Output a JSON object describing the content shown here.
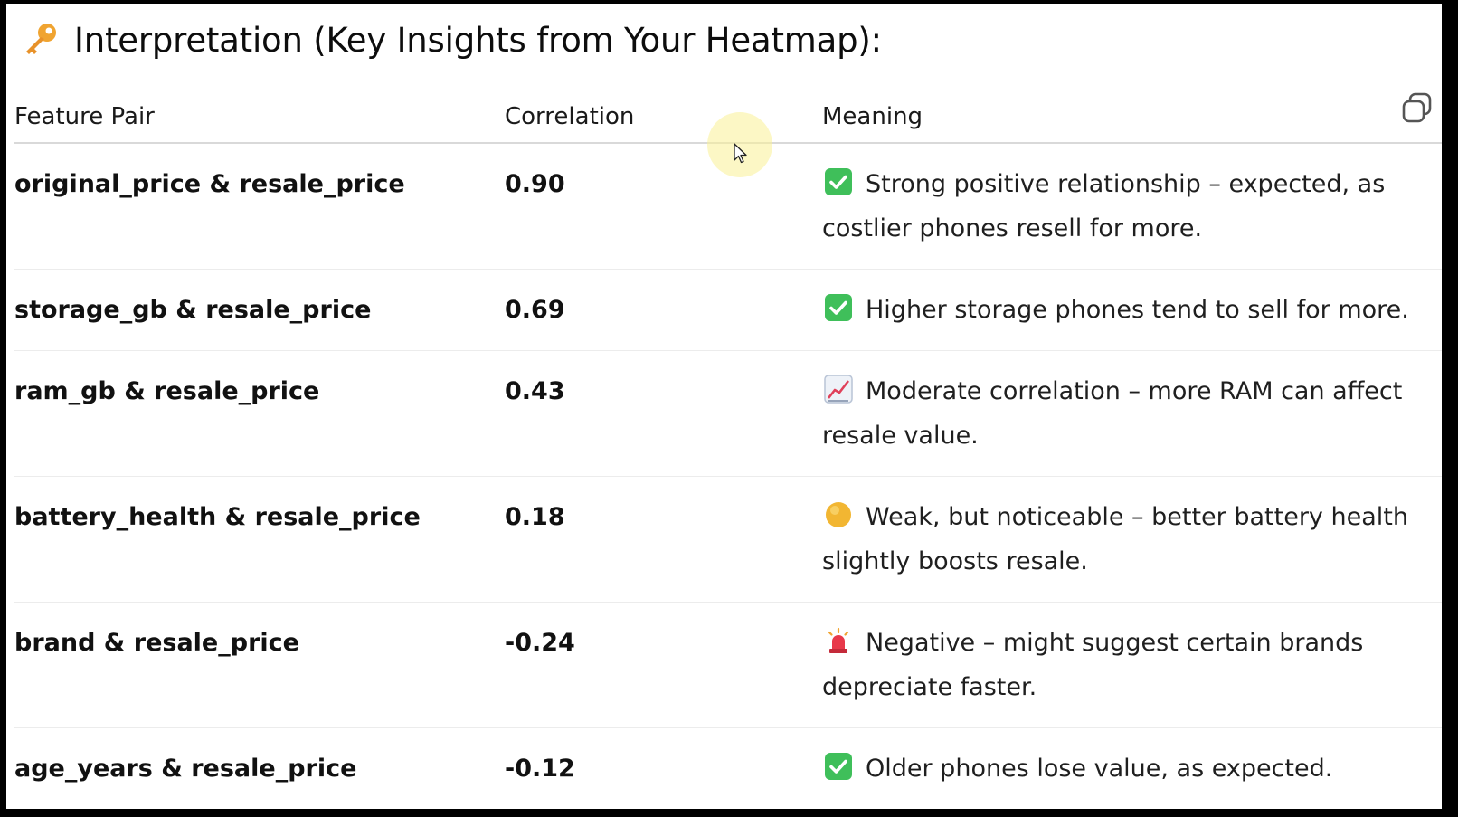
{
  "heading": {
    "icon": "key-icon",
    "text": "Interpretation (Key Insights from Your Heatmap):"
  },
  "table": {
    "headers": {
      "feature_pair": "Feature Pair",
      "correlation": "Correlation",
      "meaning": "Meaning"
    },
    "rows": [
      {
        "pair": "original_price & resale_price",
        "correlation": "0.90",
        "icon": "check-mark-icon",
        "meaning": "Strong positive relationship – expected, as costlier phones resell for more."
      },
      {
        "pair": "storage_gb & resale_price",
        "correlation": "0.69",
        "icon": "check-mark-icon",
        "meaning": "Higher storage phones tend to sell for more."
      },
      {
        "pair": "ram_gb & resale_price",
        "correlation": "0.43",
        "icon": "chart-increasing-icon",
        "meaning": "Moderate correlation – more RAM can affect resale value."
      },
      {
        "pair": "battery_health & resale_price",
        "correlation": "0.18",
        "icon": "yellow-circle-icon",
        "meaning": "Weak, but noticeable – better battery health slightly boosts resale."
      },
      {
        "pair": "brand & resale_price",
        "correlation": "-0.24",
        "icon": "siren-light-icon",
        "meaning": "Negative – might suggest certain brands depreciate faster."
      },
      {
        "pair": "age_years & resale_price",
        "correlation": "-0.12",
        "icon": "check-mark-icon",
        "meaning": "Older phones lose value, as expected."
      }
    ]
  },
  "toolbar": {
    "copy_icon": "copy-icon"
  },
  "colors": {
    "check_green": "#3fbf5a",
    "circle_yellow": "#f2b632",
    "siren_red": "#e8394a",
    "background": "#ffffff",
    "frame": "#000000"
  }
}
